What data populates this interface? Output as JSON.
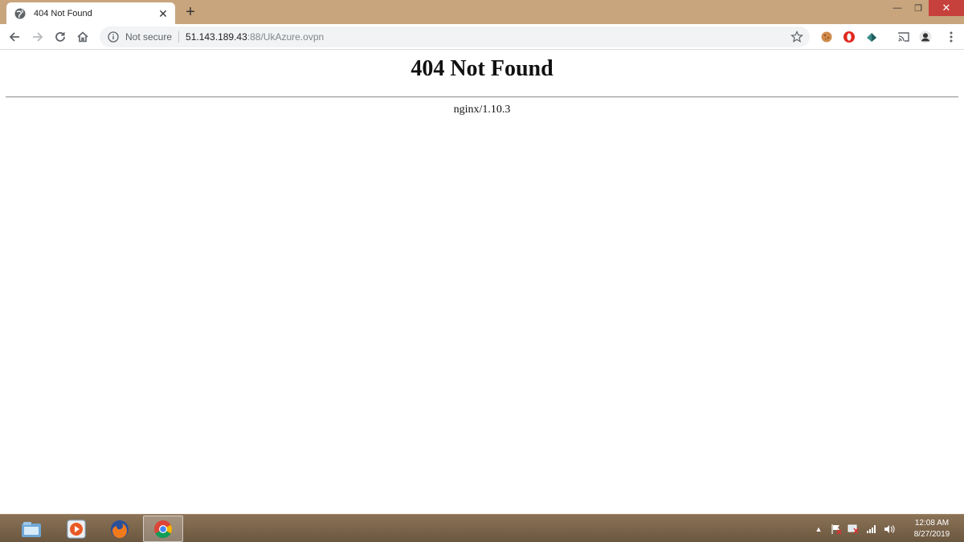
{
  "browser": {
    "tab": {
      "title": "404 Not Found",
      "close_glyph": "✕"
    },
    "new_tab_glyph": "+",
    "window_controls": {
      "minimize": "—",
      "restore": "❐",
      "close": "✕"
    },
    "omnibox": {
      "security_label": "Not secure",
      "url_host": "51.143.189.43",
      "url_rest": ":88/UkAzure.ovpn"
    },
    "icons": [
      "back-arrow-icon",
      "forward-arrow-icon",
      "reload-icon",
      "home-icon",
      "info-icon",
      "star-icon",
      "cast-icon",
      "profile-avatar-icon",
      "menu-dots-icon"
    ]
  },
  "page": {
    "heading": "404 Not Found",
    "server_signature": "nginx/1.10.3"
  },
  "taskbar": {
    "apps": [
      "windows-explorer-icon",
      "media-player-icon",
      "firefox-icon",
      "chrome-icon"
    ],
    "active_app": "chrome-icon",
    "clock": {
      "time": "12:08 AM",
      "date": "8/27/2019"
    }
  },
  "colors": {
    "tabstrip": "#c8a57c",
    "taskbar": "#7a6449",
    "close_button": "#c7413c"
  }
}
